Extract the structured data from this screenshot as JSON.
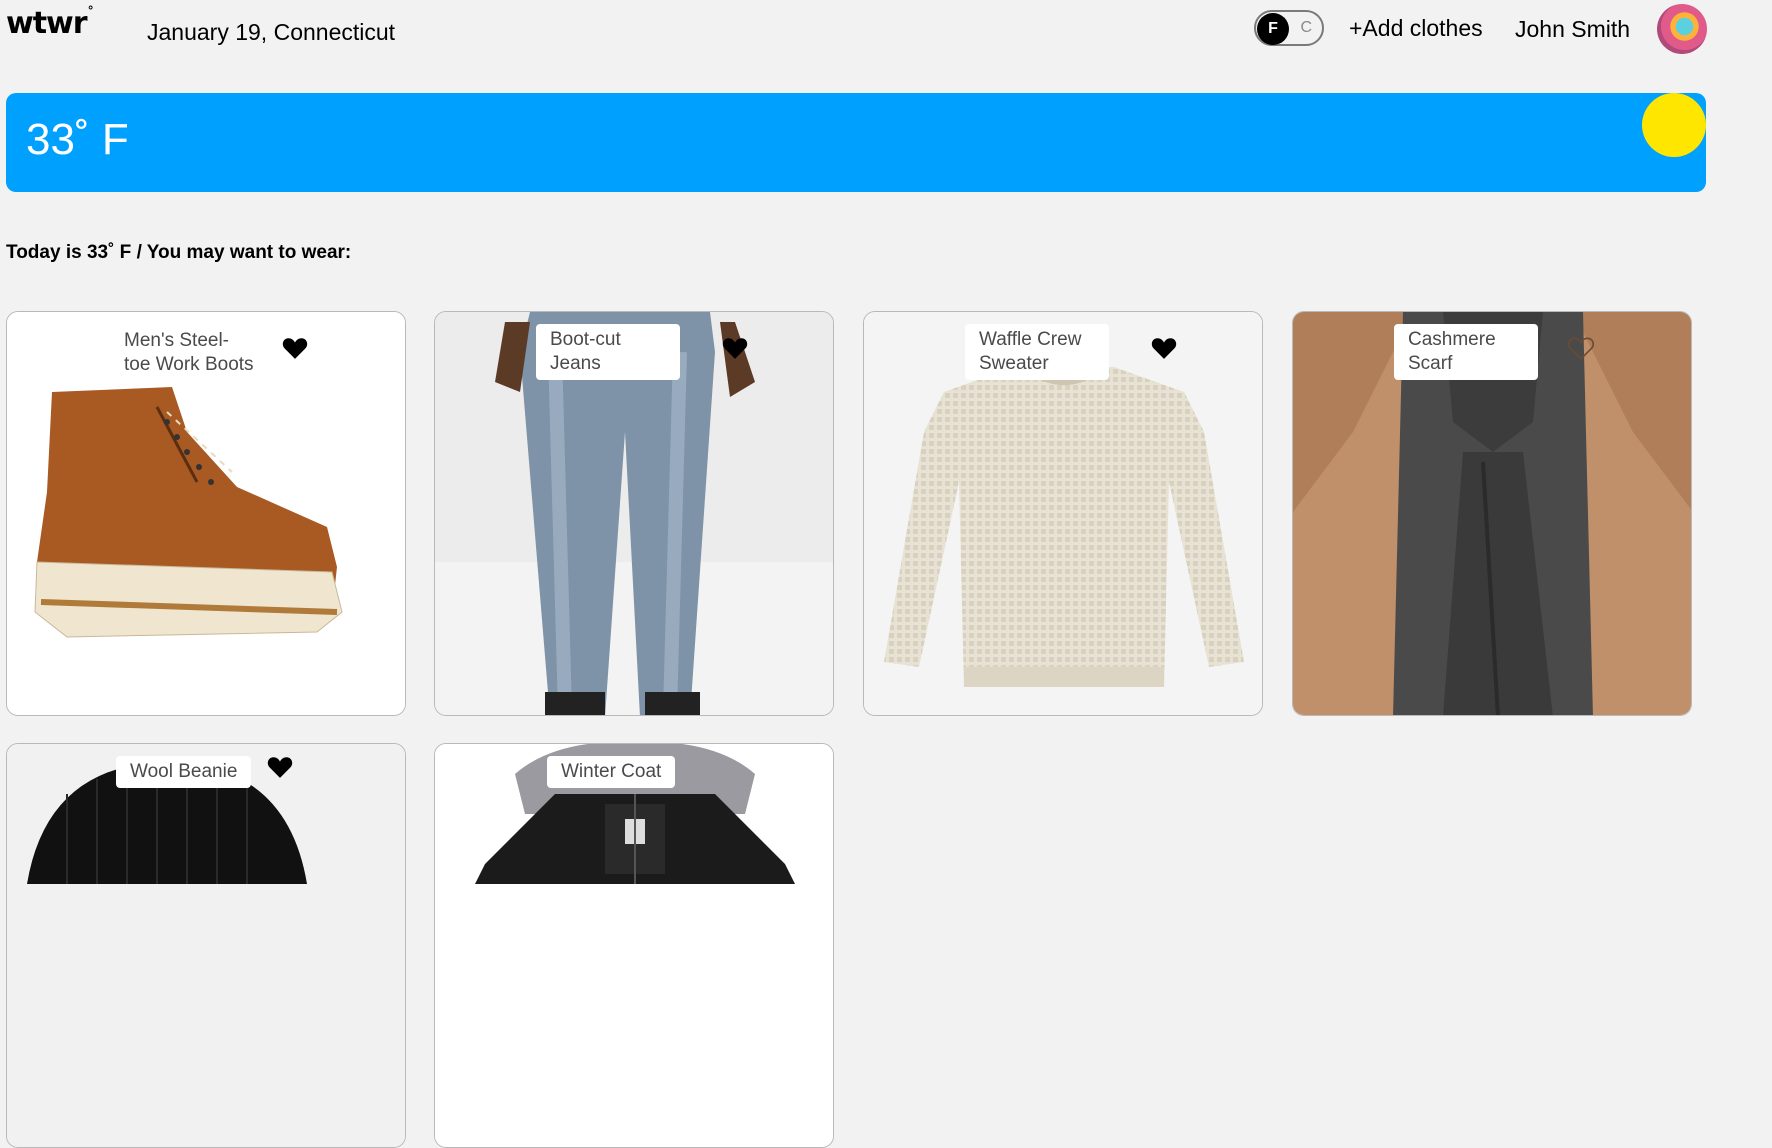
{
  "header": {
    "logo": "wtwr",
    "logo_mark": "°",
    "date_location": "January 19, Connecticut",
    "unit_toggle": {
      "selected": "F",
      "other": "C"
    },
    "add_clothes_label": "+Add clothes",
    "user_name": "John Smith",
    "avatar_icon": "user-avatar"
  },
  "weather": {
    "temperature": "33˚ F",
    "sun_icon": "sun-icon",
    "banner_color": "#00a0ff",
    "sun_color": "#ffe600"
  },
  "intro_text": "Today is 33˚ F / You may want to wear:",
  "items": [
    {
      "name": "Men's Steel-\ntoe Work Boots",
      "liked": true
    },
    {
      "name": "Boot-cut\nJeans",
      "liked": true
    },
    {
      "name": "Waffle Crew\nSweater",
      "liked": true
    },
    {
      "name": "Cashmere\nScarf",
      "liked": false
    },
    {
      "name": "Wool Beanie",
      "liked": true
    },
    {
      "name": "Winter Coat",
      "liked": false
    }
  ]
}
